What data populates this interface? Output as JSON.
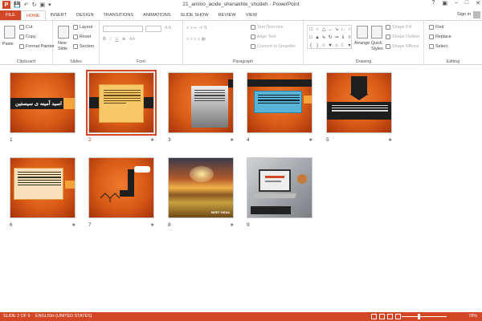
{
  "window": {
    "title": "21_amino_acide_shenakhte_shodeh - PowerPoint",
    "app_logo": "P",
    "help": "?",
    "sign_in": "Sign in"
  },
  "tabs": [
    "FILE",
    "HOME",
    "INSERT",
    "DESIGN",
    "TRANSITIONS",
    "ANIMATIONS",
    "SLIDE SHOW",
    "REVIEW",
    "VIEW"
  ],
  "active_tab": "HOME",
  "ribbon": {
    "clipboard": {
      "label": "Clipboard",
      "paste": "Paste",
      "cut": "Cut",
      "copy": "Copy",
      "format_painter": "Format Painter"
    },
    "slides": {
      "label": "Slides",
      "new_slide_1": "New",
      "new_slide_2": "Slide",
      "layout": "Layout",
      "reset": "Reset",
      "section": "Section"
    },
    "font": {
      "label": "Font",
      "bold": "B",
      "italic": "I",
      "underline": "U",
      "strike": "S",
      "aa": "AA"
    },
    "paragraph": {
      "label": "Paragraph",
      "text_direction": "Text Direction",
      "align_text": "Align Text",
      "convert_smartart": "Convert to SmartArt"
    },
    "drawing": {
      "label": "Drawing",
      "arrange": "Arrange",
      "quick_styles_1": "Quick",
      "quick_styles_2": "Styles",
      "shape_fill": "Shape Fill",
      "shape_outline": "Shape Outline",
      "shape_effects": "Shape Effects"
    },
    "editing": {
      "label": "Editing",
      "find": "Find",
      "replace": "Replace",
      "select": "Select"
    }
  },
  "slides": [
    {
      "number": "1",
      "title_text": "اسید آمینه ی سیستین",
      "star": ""
    },
    {
      "number": "2",
      "star": "★",
      "selected": true
    },
    {
      "number": "3",
      "star": "★"
    },
    {
      "number": "4",
      "star": "★"
    },
    {
      "number": "5",
      "star": "★"
    },
    {
      "number": "6",
      "star": "★"
    },
    {
      "number": "7",
      "star": "★"
    },
    {
      "number": "8",
      "star": "★",
      "caption": "MEET INDIA"
    },
    {
      "number": "9",
      "star": ""
    }
  ],
  "status": {
    "slide_of": "SLIDE 2 OF 9",
    "language": "ENGLISH (UNITED STATES)",
    "zoom": "78%",
    "zoom_fraction": 0.78
  },
  "colors": {
    "accent": "#d24726",
    "slide_orange": "#e8661f",
    "dark_band": "#1e1e1e"
  }
}
